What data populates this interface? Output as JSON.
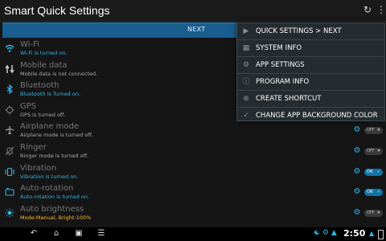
{
  "app": {
    "title": "Smart Quick Settings"
  },
  "next_bar": {
    "label": "NEXT"
  },
  "settings": [
    {
      "title": "Wi-Fi",
      "subtitle": "Wi-Fi is turned on.",
      "sub_color": "blue",
      "icon": "wifi-icon",
      "toggle": null
    },
    {
      "title": "Mobile data",
      "subtitle": "Mobile data is not connected.",
      "sub_color": "grey",
      "icon": "mobile-data-icon",
      "toggle": null
    },
    {
      "title": "Bluetooth",
      "subtitle": "Bluetooth is Turned on.",
      "sub_color": "blue",
      "icon": "bluetooth-icon",
      "toggle": null
    },
    {
      "title": "GPS",
      "subtitle": "GPS is turned off.",
      "sub_color": "grey",
      "icon": "gps-icon",
      "toggle": null
    },
    {
      "title": "Airplane mode",
      "subtitle": "Airplane mode is turned off.",
      "sub_color": "grey",
      "icon": "airplane-icon",
      "toggle": "OFF"
    },
    {
      "title": "Ringer",
      "subtitle": "Ringer mode is turned off.",
      "sub_color": "grey",
      "icon": "ringer-icon",
      "toggle": "OFF"
    },
    {
      "title": "Vibration",
      "subtitle": "Vibration is turned on.",
      "sub_color": "blue",
      "icon": "vibration-icon",
      "toggle": "ON"
    },
    {
      "title": "Auto-rotation",
      "subtitle": "Auto-rotation is turned on.",
      "sub_color": "blue",
      "icon": "auto-rotation-icon",
      "toggle": "ON"
    },
    {
      "title": "Auto brightness",
      "subtitle": "Mode:Manual, Bright:100%",
      "sub_color": "orange",
      "icon": "brightness-icon",
      "toggle": "OFF"
    }
  ],
  "menu": [
    {
      "label": "QUICK SETTINGS > NEXT",
      "icon": "play-icon"
    },
    {
      "label": "SYSTEM INFO",
      "icon": "grid-icon"
    },
    {
      "label": "APP SETTINGS",
      "icon": "gear-icon"
    },
    {
      "label": "PROGRAM INFO",
      "icon": "info-icon"
    },
    {
      "label": "CREATE SHORTCUT",
      "icon": "add-icon"
    },
    {
      "label": "CHANGE APP BACKGROUND COLOR",
      "icon": "check-icon"
    }
  ],
  "status": {
    "time": "2:50"
  },
  "colors": {
    "accent": "#33b5e5",
    "next_bar": "#1a5e8f",
    "menu_bg": "#252c31"
  }
}
